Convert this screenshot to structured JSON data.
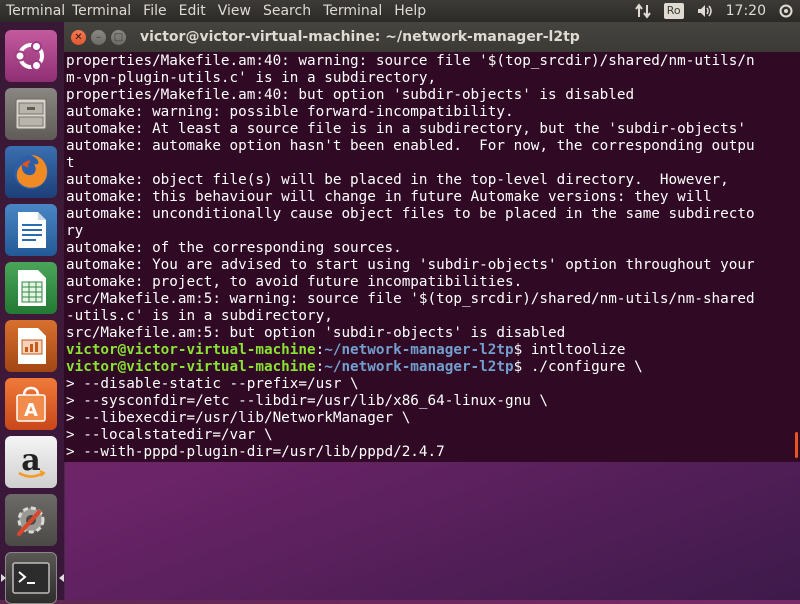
{
  "top_panel": {
    "app_name": "Terminal",
    "menus": [
      "Terminal",
      "File",
      "Edit",
      "View",
      "Search",
      "Terminal",
      "Help"
    ],
    "keyboard_layout": "Ro",
    "clock": "17:20"
  },
  "launcher": {
    "items": [
      {
        "name": "ubuntu-dash",
        "icon": "ubuntu-logo-icon"
      },
      {
        "name": "files",
        "icon": "file-cabinet-icon"
      },
      {
        "name": "firefox",
        "icon": "firefox-icon"
      },
      {
        "name": "libreoffice-writer",
        "icon": "writer-document-icon"
      },
      {
        "name": "libreoffice-calc",
        "icon": "calc-spreadsheet-icon"
      },
      {
        "name": "libreoffice-impress",
        "icon": "impress-presentation-icon"
      },
      {
        "name": "ubuntu-software",
        "icon": "software-bag-icon"
      },
      {
        "name": "amazon",
        "icon": "amazon-icon"
      },
      {
        "name": "system-settings",
        "icon": "settings-wrench-icon"
      },
      {
        "name": "terminal",
        "icon": "terminal-icon"
      }
    ]
  },
  "window": {
    "title": "victor@victor-virtual-machine: ~/network-manager-l2tp"
  },
  "terminal": {
    "lines": [
      {
        "text": "properties/Makefile.am:40: warning: source file '$(top_srcdir)/shared/nm-utils/n"
      },
      {
        "text": "m-vpn-plugin-utils.c' is in a subdirectory,"
      },
      {
        "text": "properties/Makefile.am:40: but option 'subdir-objects' is disabled"
      },
      {
        "text": "automake: warning: possible forward-incompatibility."
      },
      {
        "text": "automake: At least a source file is in a subdirectory, but the 'subdir-objects'"
      },
      {
        "text": "automake: automake option hasn't been enabled.  For now, the corresponding outpu"
      },
      {
        "text": "t"
      },
      {
        "text": "automake: object file(s) will be placed in the top-level directory.  However,"
      },
      {
        "text": "automake: this behaviour will change in future Automake versions: they will"
      },
      {
        "text": "automake: unconditionally cause object files to be placed in the same subdirecto"
      },
      {
        "text": "ry"
      },
      {
        "text": "automake: of the corresponding sources."
      },
      {
        "text": "automake: You are advised to start using 'subdir-objects' option throughout your"
      },
      {
        "text": "automake: project, to avoid future incompatibilities."
      },
      {
        "text": "src/Makefile.am:5: warning: source file '$(top_srcdir)/shared/nm-utils/nm-shared"
      },
      {
        "text": "-utils.c' is in a subdirectory,"
      },
      {
        "text": "src/Makefile.am:5: but option 'subdir-objects' is disabled"
      },
      {
        "prompt_user": "victor@victor-virtual-machine",
        "prompt_sep": ":",
        "prompt_path": "~/network-manager-l2tp",
        "command": "$ intltoolize"
      },
      {
        "prompt_user": "victor@victor-virtual-machine",
        "prompt_sep": ":",
        "prompt_path": "~/network-manager-l2tp",
        "command": "$ ./configure \\"
      },
      {
        "text": "> --disable-static --prefix=/usr \\"
      },
      {
        "text": "> --sysconfdir=/etc --libdir=/usr/lib/x86_64-linux-gnu \\"
      },
      {
        "text": "> --libexecdir=/usr/lib/NetworkManager \\"
      },
      {
        "text": "> --localstatedir=/var \\"
      },
      {
        "text": "> --with-pppd-plugin-dir=/usr/lib/pppd/2.4.7"
      }
    ]
  }
}
